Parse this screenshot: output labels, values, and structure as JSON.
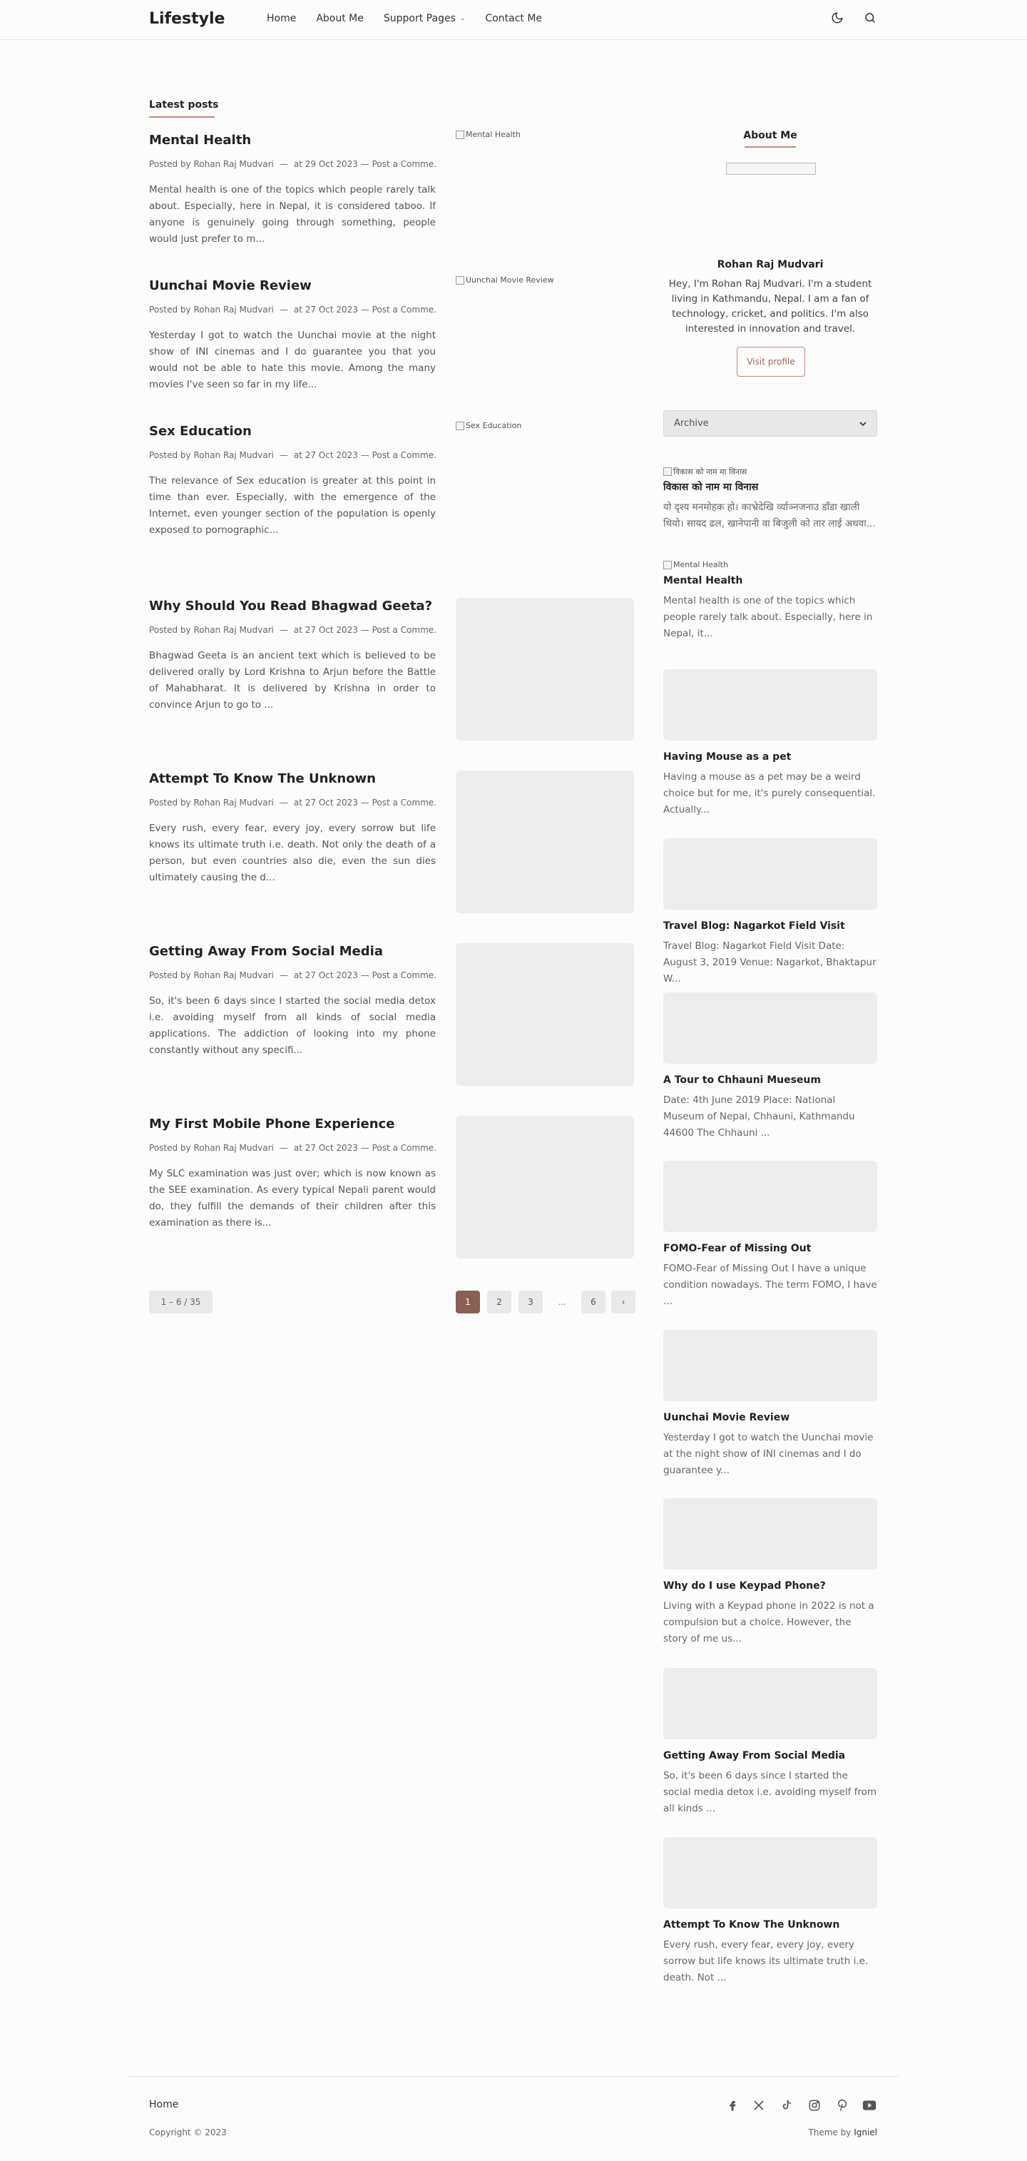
{
  "header": {
    "brand": "Lifestyle",
    "nav": [
      {
        "label": "Home"
      },
      {
        "label": "About Me"
      },
      {
        "label": "Support Pages",
        "has_dropdown": true
      },
      {
        "label": "Contact Me"
      }
    ],
    "icons": [
      "moon-icon",
      "search-icon"
    ]
  },
  "main": {
    "section_title": "Latest posts",
    "posts": [
      {
        "title": "Mental Health",
        "author": "Posted by Rohan Raj Mudvari",
        "date": "at 29 Oct 2023",
        "comment": "— Post a Comme...",
        "excerpt": "Mental health is one of the topics which people rarely talk about. Especially, here in Nepal, it is considered taboo. If anyone is genuinely going through something, people would just prefer to m...",
        "image_alt": "Mental Health"
      },
      {
        "title": "Uunchai Movie Review",
        "author": "Posted by Rohan Raj Mudvari",
        "date": "at 27 Oct 2023",
        "comment": "— Post a Comme...",
        "excerpt": "Yesterday I got to watch the Uunchai movie at the night show of INI cinemas and I do guarantee you that you would not be able to hate this movie. Among the many movies I've seen so far in my life...",
        "image_alt": "Uunchai Movie Review"
      },
      {
        "title": "Sex Education",
        "author": "Posted by Rohan Raj Mudvari",
        "date": "at 27 Oct 2023",
        "comment": "— Post a Comme...",
        "excerpt": "The relevance of Sex education is greater at this point in time than ever. Especially, with the emergence of the Internet, even younger section of the population is openly exposed to pornographic...",
        "image_alt": "Sex Education"
      },
      {
        "title": "Why Should You Read Bhagwad Geeta?",
        "author": "Posted by Rohan Raj Mudvari",
        "date": "at 27 Oct 2023",
        "comment": "— Post a Comme...",
        "excerpt": "Bhagwad Geeta is an ancient text which is believed to be delivered orally by Lord Krishna to Arjun before the Battle of Mahabharat. It is delivered by Krishna in order to convince Arjun to go to ..."
      },
      {
        "title": "Attempt To Know The Unknown",
        "author": "Posted by Rohan Raj Mudvari",
        "date": "at 27 Oct 2023",
        "comment": "— Post a Comme...",
        "excerpt": "Every rush, every fear, every joy, every sorrow but life knows its ultimate truth i.e. death. Not only the death of a person, but even countries also die, even the sun dies ultimately causing the d..."
      },
      {
        "title": "Getting Away From Social Media",
        "author": "Posted by Rohan Raj Mudvari",
        "date": "at 27 Oct 2023",
        "comment": "— Post a Comme...",
        "excerpt": "So, it's been 6 days since I started the social media detox i.e. avoiding myself from all kinds of social media applications. The addiction of looking into my phone constantly without any specifi..."
      },
      {
        "title": "My First Mobile Phone Experience",
        "author": "Posted by Rohan Raj Mudvari",
        "date": "at 27 Oct 2023",
        "comment": "— Post a Comme...",
        "excerpt": "My SLC examination was just over; which is now known as the SEE examination. As every typical Nepali parent would do, they fulfill the demands of their children after this examination as there is..."
      }
    ],
    "pagination": {
      "count": "1 – 6 / 35",
      "pages": [
        "1",
        "2",
        "3"
      ],
      "ellipsis": "...",
      "last": "6",
      "next": "›",
      "current": "1"
    }
  },
  "sidebar": {
    "about_title": "About Me",
    "name": "Rohan Raj Mudvari",
    "bio": "Hey, I'm Rohan Raj Mudvari. I'm a student living in Kathmandu, Nepal. I am a fan of technology, cricket, and politics. I'm also interested in innovation and travel.",
    "visit_label": "Visit profile",
    "archive_label": "Archive",
    "posts": [
      {
        "title": "विकास को नाम मा विनास",
        "image_alt": "विकास को नाम मा विनास",
        "excerpt": "यो दृश्य मनमोहक हो। काभ्रेदेखि र्व्याञ्नजनाउ डाँडा खाली थियो। सायद ढल, खानेपानी वा बिजुली को तार लाई अथवा..."
      },
      {
        "title": "Mental Health",
        "image_alt": "Mental Health",
        "excerpt": "Mental health is one of the topics which people rarely talk about. Especially, here in Nepal, it..."
      },
      {
        "title": "Having Mouse as a pet",
        "excerpt": "Having a mouse as a pet may be a weird choice but for me, it's purely consequential. Actually..."
      },
      {
        "title": "Travel Blog: Nagarkot Field Visit",
        "excerpt": "Travel Blog: Nagarkot Field Visit Date: August 3, 2019 Venue: Nagarkot, Bhaktapur W..."
      },
      {
        "title": "A Tour to Chhauni Mueseum",
        "excerpt": "Date: 4th June 2019 Place:    National Museum of Nepal, Chhauni, Kathmandu 44600 The Chhauni ..."
      },
      {
        "title": "FOMO-Fear of Missing Out",
        "excerpt": "FOMO-Fear of Missing Out   I have a unique condition nowadays. The term FOMO, I have ..."
      },
      {
        "title": "Uunchai Movie Review",
        "excerpt": "Yesterday I got to watch the Uunchai movie at the night show of INI cinemas and I do guarantee y..."
      },
      {
        "title": "Why do I use Keypad Phone?",
        "excerpt": "Living with a Keypad phone in 2022 is not a compulsion but a choice. However, the story of me us..."
      },
      {
        "title": "Getting Away From Social Media",
        "excerpt": "So, it's been 6 days since I started the social media detox i.e. avoiding myself from all kinds ..."
      },
      {
        "title": "Attempt To Know The Unknown",
        "excerpt": "Every rush, every fear, every joy, every sorrow but life knows its ultimate truth i.e. death. Not ..."
      }
    ]
  },
  "footer": {
    "home": "Home",
    "copyright": "Copyright © 2023",
    "theme_by_prefix": "Theme by",
    "theme_by_name": "Igniel",
    "social": [
      "facebook-icon",
      "x-icon",
      "tiktok-icon",
      "instagram-icon",
      "pinterest-icon",
      "youtube-icon"
    ]
  },
  "colors": {
    "accent": "#c9867a",
    "active_page": "#8b5e56",
    "placeholder": "#ededed"
  }
}
